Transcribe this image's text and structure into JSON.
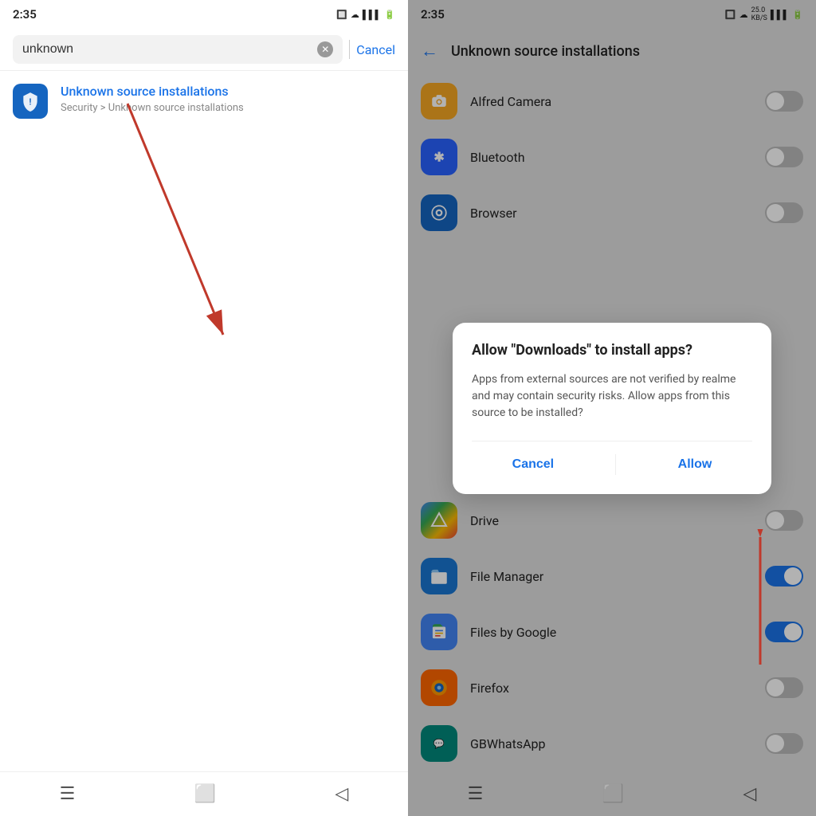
{
  "left": {
    "status": {
      "time": "2:35",
      "icons": "🔋"
    },
    "search": {
      "value": "unknown",
      "clear_label": "✕",
      "cancel_label": "Cancel"
    },
    "result": {
      "title_highlight": "Unknown",
      "title_rest": " source installations",
      "subtitle": "Security > Unknown source installations"
    },
    "nav": {
      "menu": "☰",
      "home": "⬜",
      "back": "◁"
    }
  },
  "right": {
    "status": {
      "time": "2:35",
      "icons": "🔋"
    },
    "header": {
      "back_label": "←",
      "title": "Unknown source installations"
    },
    "apps": [
      {
        "name": "Alfred Camera",
        "icon_class": "alfred",
        "icon": "📷",
        "enabled": false
      },
      {
        "name": "Bluetooth",
        "icon_class": "bluetooth",
        "icon": "✱",
        "enabled": false
      },
      {
        "name": "Browser",
        "icon_class": "browser",
        "icon": "◉",
        "enabled": false
      },
      {
        "name": "Drive",
        "icon_class": "drive",
        "icon": "△",
        "enabled": false
      },
      {
        "name": "File Manager",
        "icon_class": "filemanager",
        "icon": "📁",
        "enabled": true
      },
      {
        "name": "Files by Google",
        "icon_class": "filesbygoogle",
        "icon": "📂",
        "enabled": true
      },
      {
        "name": "Firefox",
        "icon_class": "firefox",
        "icon": "🦊",
        "enabled": false
      },
      {
        "name": "GBWhatsApp",
        "icon_class": "gbwhatsapp",
        "icon": "💬",
        "enabled": false
      }
    ],
    "dialog": {
      "title": "Allow \"Downloads\" to install apps?",
      "body": "Apps from external sources are not verified by realme and may contain security risks. Allow apps from this source to be installed?",
      "cancel_label": "Cancel",
      "allow_label": "Allow"
    },
    "nav": {
      "menu": "☰",
      "home": "⬜",
      "back": "◁"
    }
  }
}
